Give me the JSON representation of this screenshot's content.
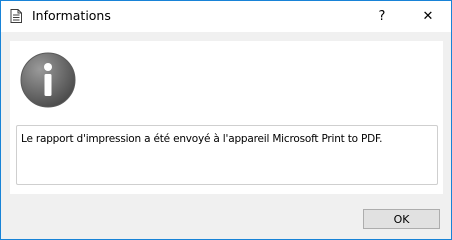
{
  "window": {
    "title": "Informations",
    "title_icon": "document-icon",
    "help_glyph": "?",
    "close_glyph": "✕"
  },
  "dialog": {
    "icon": "info-icon",
    "message": "Le rapport d'impression a été envoyé à l'appareil Microsoft Print to PDF.",
    "ok_label": "OK"
  },
  "colors": {
    "accent_border": "#1883d7",
    "background": "#f0f0f0",
    "button_face": "#e1e1e1"
  }
}
